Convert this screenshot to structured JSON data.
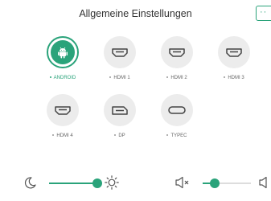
{
  "header": {
    "title": "Allgemeine Einstellungen",
    "more_label": "··"
  },
  "sources": [
    {
      "label": "ANDROID",
      "active": true,
      "icon": "android-icon"
    },
    {
      "label": "HDMI 1",
      "active": false,
      "icon": "hdmi-port-icon"
    },
    {
      "label": "HDMI 2",
      "active": false,
      "icon": "hdmi-port-icon"
    },
    {
      "label": "HDMI 3",
      "active": false,
      "icon": "hdmi-port-icon"
    },
    {
      "label": "HDMI 4",
      "active": false,
      "icon": "hdmi-port-icon"
    },
    {
      "label": "DP",
      "active": false,
      "icon": "displayport-icon"
    },
    {
      "label": "TYPEC",
      "active": false,
      "icon": "usb-c-icon"
    }
  ],
  "brightness": {
    "level": 1.0,
    "low_icon": "moon-icon",
    "high_icon": "sun-icon"
  },
  "volume": {
    "level": 0.25,
    "low_icon": "speaker-muted-icon",
    "high_icon": "speaker-icon"
  },
  "colors": {
    "accent": "#2aa37a",
    "inactive_circle": "#ececec"
  }
}
